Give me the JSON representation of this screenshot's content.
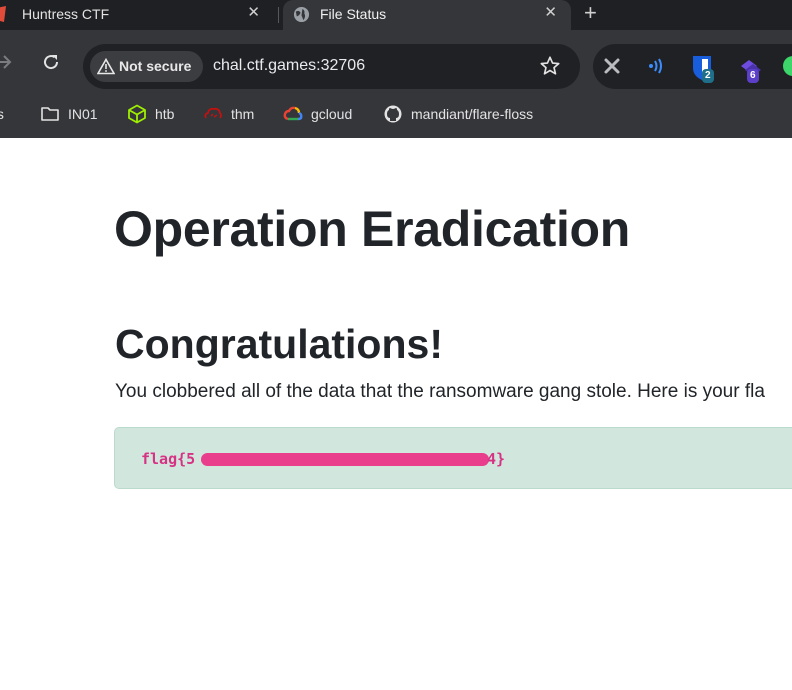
{
  "browser": {
    "tabs": [
      {
        "title": "Huntress CTF",
        "active": false
      },
      {
        "title": "File Status",
        "active": true
      }
    ],
    "omnibox": {
      "security_label": "Not secure",
      "url": "chal.ctf.games:32706"
    },
    "extension_badges": {
      "bitwarden": "2",
      "stack": "6"
    },
    "bookmarks": [
      {
        "label": "ols",
        "icon": "folder-icon"
      },
      {
        "label": "IN01",
        "icon": "folder-icon"
      },
      {
        "label": "htb",
        "icon": "htb-cube-icon"
      },
      {
        "label": "thm",
        "icon": "thm-cloud-icon"
      },
      {
        "label": "gcloud",
        "icon": "google-cloud-icon"
      },
      {
        "label": "mandiant/flare-floss",
        "icon": "github-icon"
      }
    ]
  },
  "page": {
    "title": "Operation Eradication",
    "heading": "Congratulations!",
    "message": "You clobbered all of the data that the ransomware gang stole. Here is your fla",
    "flag_prefix": "flag{5",
    "flag_suffix": "4}"
  },
  "colors": {
    "chrome_dark": "#1f2023",
    "chrome_toolbar": "#35363a",
    "alert_success_bg": "#d1e7dd",
    "flag_text": "#d63384",
    "redaction": "#e83e8c"
  }
}
